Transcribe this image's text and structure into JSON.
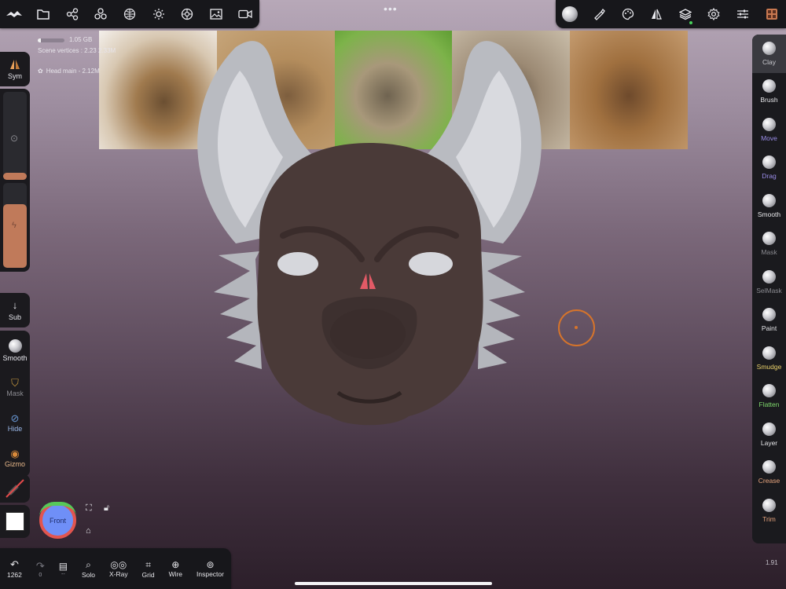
{
  "stats": {
    "memory": "1.05 GB",
    "memory_fill_pct": 12,
    "scene_vertices": "Scene vertices : 2.23",
    "scene_vertices_tail": "2.33M",
    "head_label": "Head main - 2.12M"
  },
  "top_left_icons": [
    "nomad-logo-icon",
    "folder-icon",
    "scene-graph-icon",
    "meshes-icon",
    "topology-icon",
    "light-icon",
    "material-icon",
    "image-icon",
    "camera-icon"
  ],
  "top_right_icons": [
    "sculpt-tool-icon",
    "brush-icon",
    "palette-icon",
    "symmetry-icon",
    "layers-icon",
    "settings-icon",
    "sliders-icon",
    "interface-icon"
  ],
  "left": {
    "sym": "Sym",
    "sub": "Sub",
    "smooth": "Smooth",
    "mask": "Mask",
    "hide": "Hide",
    "gizmo": "Gizmo",
    "radius_slider_fill": 0.08,
    "intensity_slider_fill": 0.75
  },
  "right_tools": [
    {
      "label": "Clay",
      "color": "#c9c9ce",
      "active": true
    },
    {
      "label": "Brush",
      "color": "#e7e7ea"
    },
    {
      "label": "Move",
      "color": "#9a8ce8"
    },
    {
      "label": "Drag",
      "color": "#9a8ce8"
    },
    {
      "label": "Smooth",
      "color": "#e7e7ea"
    },
    {
      "label": "Mask",
      "color": "#8a8a90"
    },
    {
      "label": "SelMask",
      "color": "#8a8a90"
    },
    {
      "label": "Paint",
      "color": "#e7e7ea"
    },
    {
      "label": "Smudge",
      "color": "#e9d06a"
    },
    {
      "label": "Flatten",
      "color": "#7fd96c"
    },
    {
      "label": "Layer",
      "color": "#e7e7ea"
    },
    {
      "label": "Crease",
      "color": "#e8a57e"
    },
    {
      "label": "Trim",
      "color": "#e8a57e"
    }
  ],
  "bottom": {
    "undo_count": "1262",
    "redo_count": "0",
    "dash": "--",
    "solo": "Solo",
    "xray": "X-Ray",
    "grid": "Grid",
    "wire": "Wire",
    "inspector": "Inspector"
  },
  "view_cube": "Front",
  "version": "1.91",
  "colors": {
    "accent_orange": "#d6742b",
    "mask_body": "#4a3a38",
    "ears": "#b7b9bf"
  }
}
